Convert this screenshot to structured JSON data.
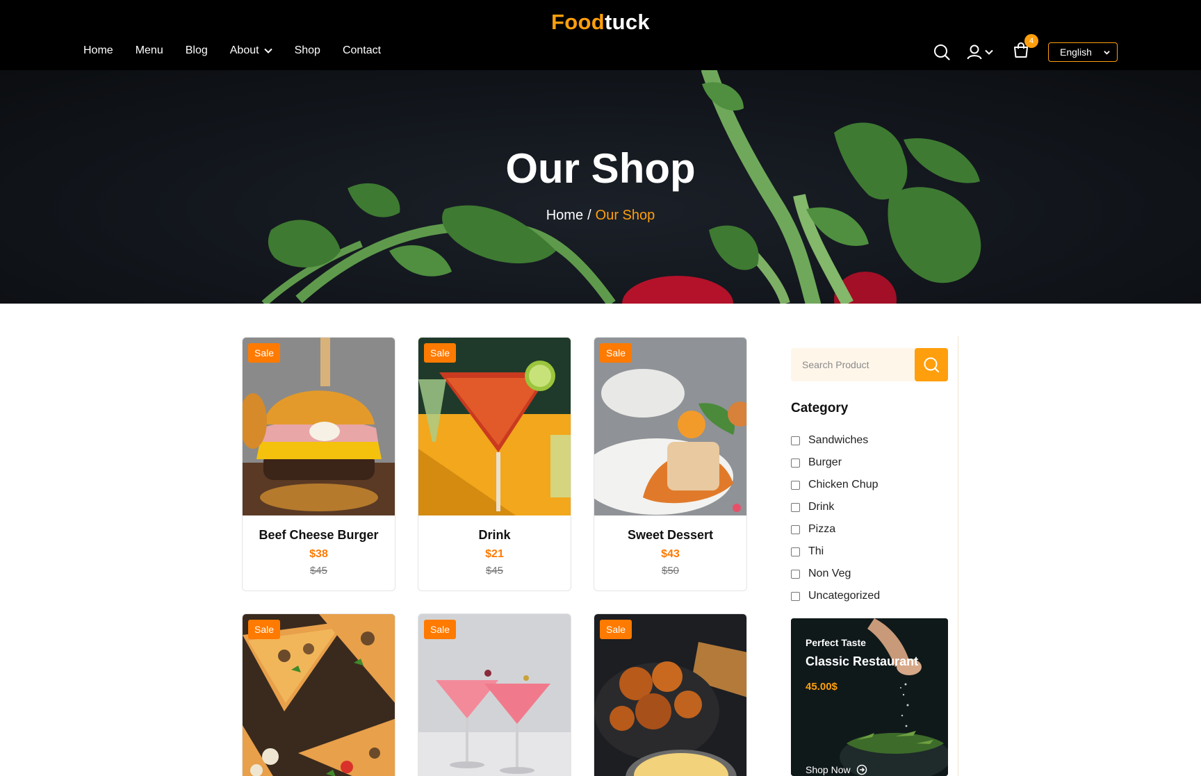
{
  "brand": {
    "part1": "Food",
    "part2": "tuck"
  },
  "nav": {
    "items": [
      {
        "label": "Home"
      },
      {
        "label": "Menu"
      },
      {
        "label": "Blog"
      },
      {
        "label": "About"
      },
      {
        "label": "Shop"
      },
      {
        "label": "Contact"
      }
    ],
    "cart_count": "4",
    "language": "English"
  },
  "banner": {
    "title": "Our Shop",
    "breadcrumb": {
      "home": "Home",
      "separator": "/",
      "current": "Our Shop"
    }
  },
  "products": [
    {
      "badge": "Sale",
      "name": "Beef Cheese Burger",
      "price": "$38",
      "old_price": "$45"
    },
    {
      "badge": "Sale",
      "name": "Drink",
      "price": "$21",
      "old_price": "$45"
    },
    {
      "badge": "Sale",
      "name": "Sweet Dessert",
      "price": "$43",
      "old_price": "$50"
    },
    {
      "badge": "Sale"
    },
    {
      "badge": "Sale"
    },
    {
      "badge": "Sale"
    }
  ],
  "sidebar": {
    "search_placeholder": "Search Product",
    "category_title": "Category",
    "categories": [
      {
        "label": "Sandwiches"
      },
      {
        "label": "Burger"
      },
      {
        "label": "Chicken Chup"
      },
      {
        "label": "Drink"
      },
      {
        "label": "Pizza"
      },
      {
        "label": "Thi"
      },
      {
        "label": "Non Veg"
      },
      {
        "label": "Uncategorized"
      }
    ],
    "promo": {
      "subtitle": "Perfect Taste",
      "title": "Classic Restaurant",
      "price": "45.00$",
      "cta": "Shop Now"
    }
  },
  "colors": {
    "accent": "#ff9f0d",
    "sale": "#ff7a00",
    "header_bg": "#000000"
  }
}
